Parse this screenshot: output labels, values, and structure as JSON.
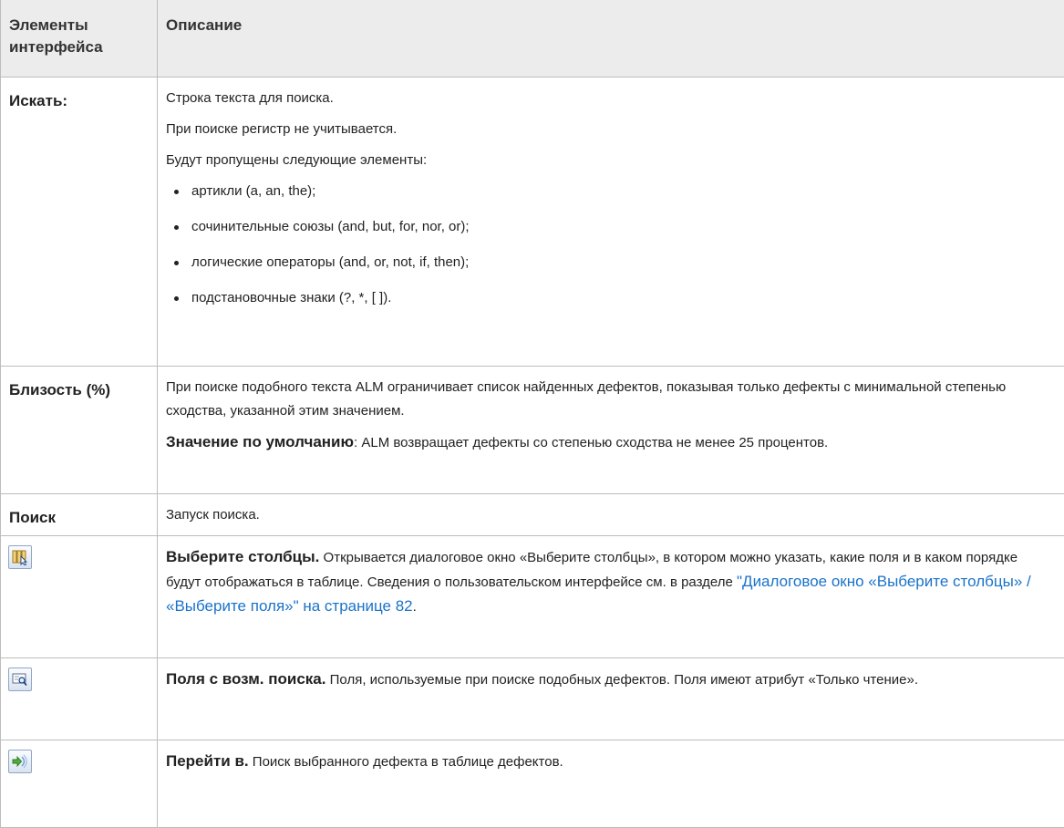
{
  "header": {
    "col1": "Элементы интерфейса",
    "col2": "Описание"
  },
  "rows": {
    "search": {
      "label": "Искать:",
      "p1": "Строка текста для поиска.",
      "p2": "При поиске регистр не учитывается.",
      "p3": "Будут пропущены следующие элементы:",
      "bullets": [
        "артикли (a, an, the);",
        "сочинительные союзы (and, but, for, nor, or);",
        "логические операторы (and, or, not, if, then);",
        "подстановочные знаки (?, *, [ ])."
      ]
    },
    "similarity": {
      "label": "Близость (%)",
      "p1": "При поиске подобного текста ALM ограничивает список найденных дефектов, показывая только дефекты с минимальной степенью сходства, указанной этим значением.",
      "default_label": "Значение по умолчанию",
      "default_text": ": ALM возвращает дефекты со степенью сходства не менее 25 процентов."
    },
    "find": {
      "label": "Поиск",
      "text": "Запуск поиска."
    },
    "select_columns": {
      "icon": "select-columns-icon",
      "title": "Выберите столбцы.",
      "text": " Открывается диалоговое окно «Выберите столбцы», в котором можно указать, какие поля и в каком порядке будут отображаться в таблице. Сведения о пользовательском интерфейсе см. в разделе ",
      "link": "\"Диалоговое окно «Выберите столбцы» / «Выберите поля»\" на странице 82",
      "end": "."
    },
    "search_fields": {
      "icon": "search-fields-icon",
      "title": "Поля с возм. поиска.",
      "text": " Поля, используемые при поиске подобных дефектов. Поля имеют атрибут «Только чтение»."
    },
    "go_to": {
      "icon": "go-to-defect-icon",
      "title": "Перейти в.",
      "text": " Поиск выбранного дефекта в таблице дефектов."
    }
  },
  "colors": {
    "header_bg": "#ececec",
    "border": "#bdbdbd",
    "link": "#1a73c9"
  }
}
